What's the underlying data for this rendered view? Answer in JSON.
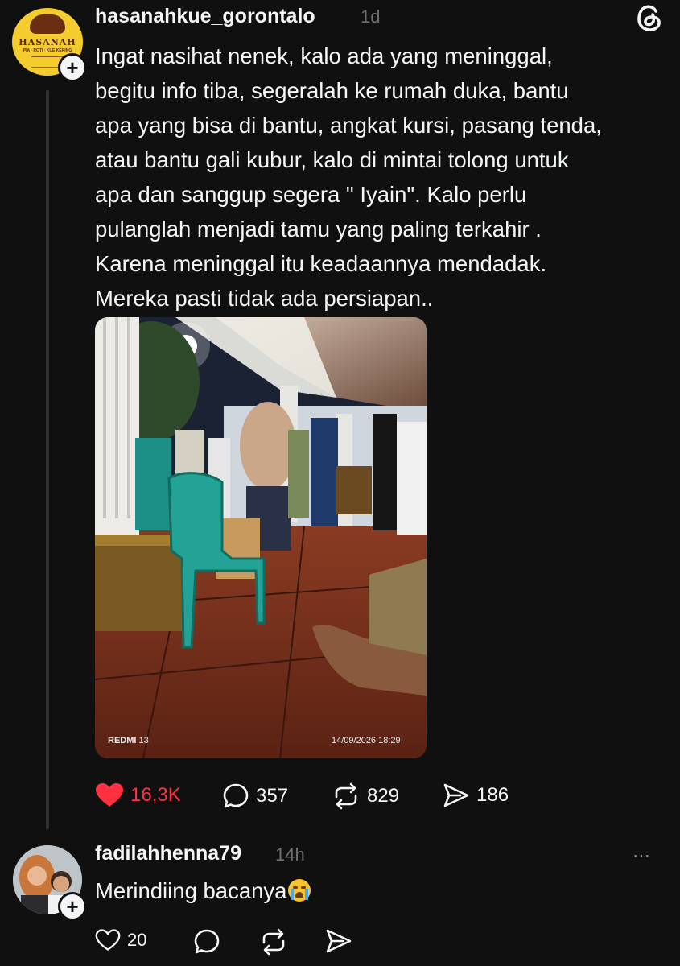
{
  "post": {
    "username": "hasanahkue_gorontalo",
    "time": "1d",
    "avatar_logo": {
      "name": "HASANAH",
      "tagline": "PIA · ROTI · KUE KERING"
    },
    "text": "Ingat nasihat nenek, kalo ada yang meninggal,\nbegitu info tiba, segeralah ke rumah duka, bantu\napa yang bisa di bantu, angkat kursi, pasang tenda,\natau bantu gali kubur, kalo di mintai tolong untuk\napa dan sanggup segera \" Iyain\". Kalo perlu\npulanglah menjadi tamu yang paling terkahir .\nKarena meninggal itu keadaannya mendadak.\nMereka pasti tidak ada persiapan..",
    "photo": {
      "watermark_brand": "REDMI",
      "watermark_model": "13",
      "watermark_date": "14/09/2026 18:29"
    },
    "likes": "16,3K",
    "replies": "357",
    "reposts": "829",
    "shares": "186",
    "like_color": "#ff3040"
  },
  "comment": {
    "username": "fadilahhenna79",
    "time": "14h",
    "more_icon": "⋯",
    "text": "Merindiing bacanya",
    "emoji": "loudly-crying-face",
    "likes": "20"
  },
  "icons": {
    "threads": "threads-logo-icon",
    "heart": "heart-icon",
    "reply": "comment-bubble-icon",
    "repost": "repost-icon",
    "share": "send-icon"
  }
}
